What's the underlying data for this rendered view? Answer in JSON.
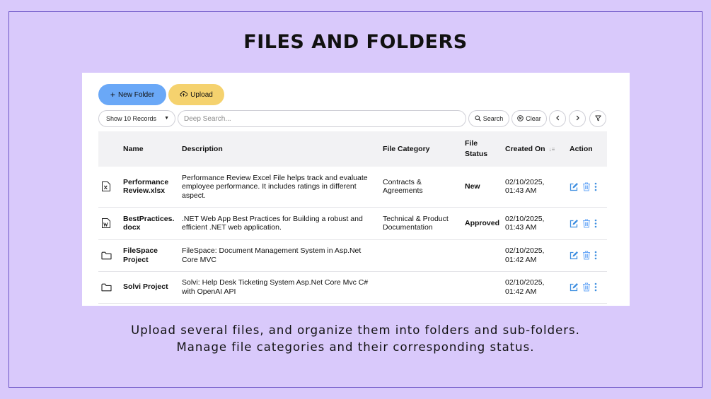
{
  "page": {
    "title": "FILES AND FOLDERS",
    "tagline_line1": "Upload several files, and organize them into folders and sub-folders.",
    "tagline_line2": "Manage file categories and their corresponding status."
  },
  "toolbar": {
    "new_folder_label": "New Folder",
    "upload_label": "Upload",
    "records_select_value": "Show 10 Records",
    "search_placeholder": "Deep Search...",
    "search_label": "Search",
    "clear_label": "Clear"
  },
  "table": {
    "headers": {
      "name": "Name",
      "description": "Description",
      "file_category": "File Category",
      "file_status_line1": "File",
      "file_status_line2": "Status",
      "created_on": "Created On",
      "action": "Action"
    },
    "rows": [
      {
        "type_icon": "excel-file-icon",
        "name": "Performance Review.xlsx",
        "description": "Performance Review Excel File helps track and evaluate employee performance. It includes ratings in different aspect.",
        "category": "Contracts & Agreements",
        "status": "New",
        "created_date": "02/10/2025,",
        "created_time": "01:43 AM"
      },
      {
        "type_icon": "word-file-icon",
        "name": "BestPractices.docx",
        "description": ".NET Web App Best Practices for Building a robust and efficient .NET web application.",
        "category": "Technical & Product Documentation",
        "status": "Approved",
        "created_date": "02/10/2025,",
        "created_time": "01:43 AM"
      },
      {
        "type_icon": "folder-icon",
        "name": "FileSpace Project",
        "description": "FileSpace: Document Management System in Asp.Net Core MVC",
        "category": "",
        "status": "",
        "created_date": "02/10/2025,",
        "created_time": "01:42 AM"
      },
      {
        "type_icon": "folder-icon",
        "name": "Solvi Project",
        "description": "Solvi: Help Desk Ticketing System Asp.Net Core Mvc C# with OpenAI API",
        "category": "",
        "status": "",
        "created_date": "02/10/2025,",
        "created_time": "01:42 AM"
      }
    ]
  },
  "colors": {
    "background": "#d9c9fb",
    "new_folder_button": "#6aa8f7",
    "upload_button": "#f5d26e",
    "name_link": "#5a9fe6",
    "status_new": "#cdb04b",
    "status_approved": "#68c1ee",
    "edit_icon": "#3f8fe0",
    "delete_icon": "#6aa8f7",
    "more_icon": "#3f8fe0"
  }
}
